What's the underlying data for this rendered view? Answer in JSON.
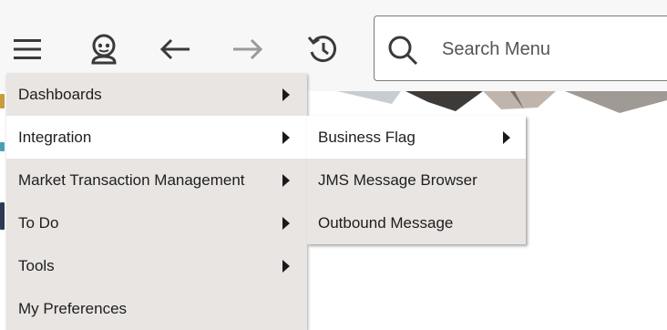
{
  "toolbar": {
    "menu_icon": "hamburger-icon",
    "home_icon": "user-portal-icon",
    "back_icon": "arrow-left-icon",
    "forward_icon": "arrow-right-icon",
    "history_icon": "history-icon"
  },
  "search": {
    "placeholder": "Search Menu",
    "value": ""
  },
  "menu": {
    "items": [
      {
        "label": "Dashboards",
        "has_submenu": true
      },
      {
        "label": "Integration",
        "has_submenu": true
      },
      {
        "label": "Market Transaction Management",
        "has_submenu": true
      },
      {
        "label": "To Do",
        "has_submenu": true
      },
      {
        "label": "Tools",
        "has_submenu": true
      },
      {
        "label": "My Preferences",
        "has_submenu": false
      }
    ]
  },
  "submenu": {
    "items": [
      {
        "label": "Business Flag",
        "has_submenu": true
      },
      {
        "label": "JMS Message Browser",
        "has_submenu": false
      },
      {
        "label": "Outbound Message",
        "has_submenu": false
      }
    ]
  },
  "colors": {
    "menu_bg": "#e9e5e3",
    "menu_active_bg": "#ffffff",
    "toolbar_bg": "#f7f7f7"
  }
}
